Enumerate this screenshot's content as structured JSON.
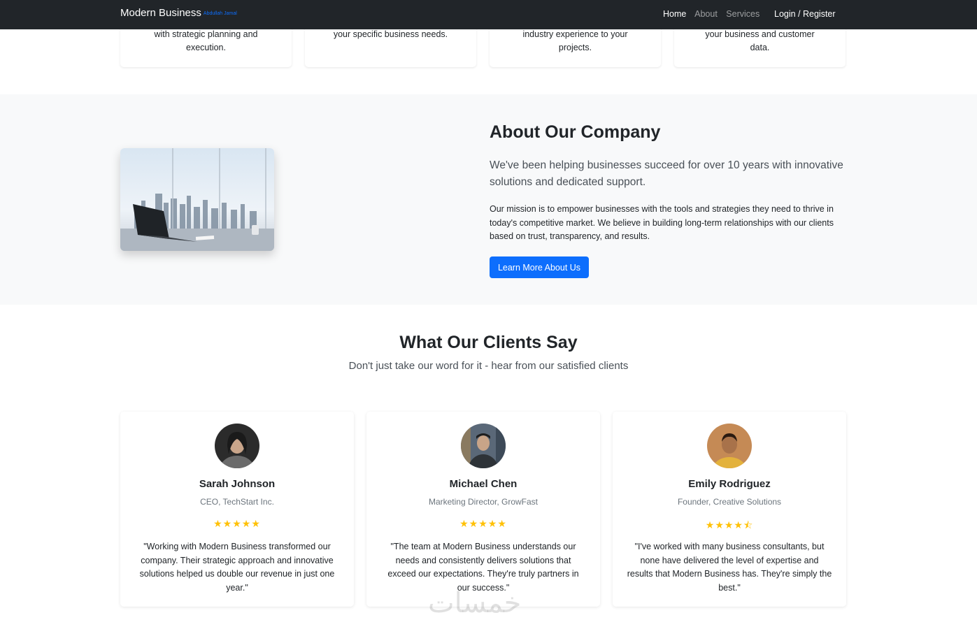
{
  "navbar": {
    "brand": "Modern Business",
    "brand_sub": "Abdullah Jamal",
    "links": [
      "Home",
      "About",
      "Services"
    ],
    "login": "Login / Register"
  },
  "services": {
    "card_texts": [
      "with strategic planning and execution.",
      "your specific business needs.",
      "industry experience to your projects.",
      "your business and customer data."
    ]
  },
  "about": {
    "title": "About Our Company",
    "lead": "We've been helping businesses succeed for over 10 years with innovative solutions and dedicated support.",
    "text": "Our mission is to empower businesses with the tools and strategies they need to thrive in today's competitive market. We believe in building long-term relationships with our clients based on trust, transparency, and results.",
    "button": "Learn More About Us"
  },
  "testimonials": {
    "title": "What Our Clients Say",
    "subtitle": "Don't just take our word for it - hear from our satisfied clients",
    "items": [
      {
        "name": "Sarah Johnson",
        "role": "CEO, TechStart Inc.",
        "rating": 5,
        "stars": "★★★★★",
        "quote": "\"Working with Modern Business transformed our company. Their strategic approach and innovative solutions helped us double our revenue in just one year.\""
      },
      {
        "name": "Michael Chen",
        "role": "Marketing Director, GrowFast",
        "rating": 5,
        "stars": "★★★★★",
        "quote": "\"The team at Modern Business understands our needs and consistently delivers solutions that exceed our expectations. They're truly partners in our success.\""
      },
      {
        "name": "Emily Rodriguez",
        "role": "Founder, Creative Solutions",
        "rating": 4.5,
        "stars": "★★★★⯪",
        "quote": "\"I've worked with many business consultants, but none have delivered the level of expertise and results that Modern Business has. They're simply the best.\""
      }
    ]
  },
  "watermark": "خمسات",
  "colors": {
    "navbar_bg": "#212529",
    "primary": "#0d6efd",
    "star": "#ffc107",
    "section_bg": "#f8f9fa"
  }
}
